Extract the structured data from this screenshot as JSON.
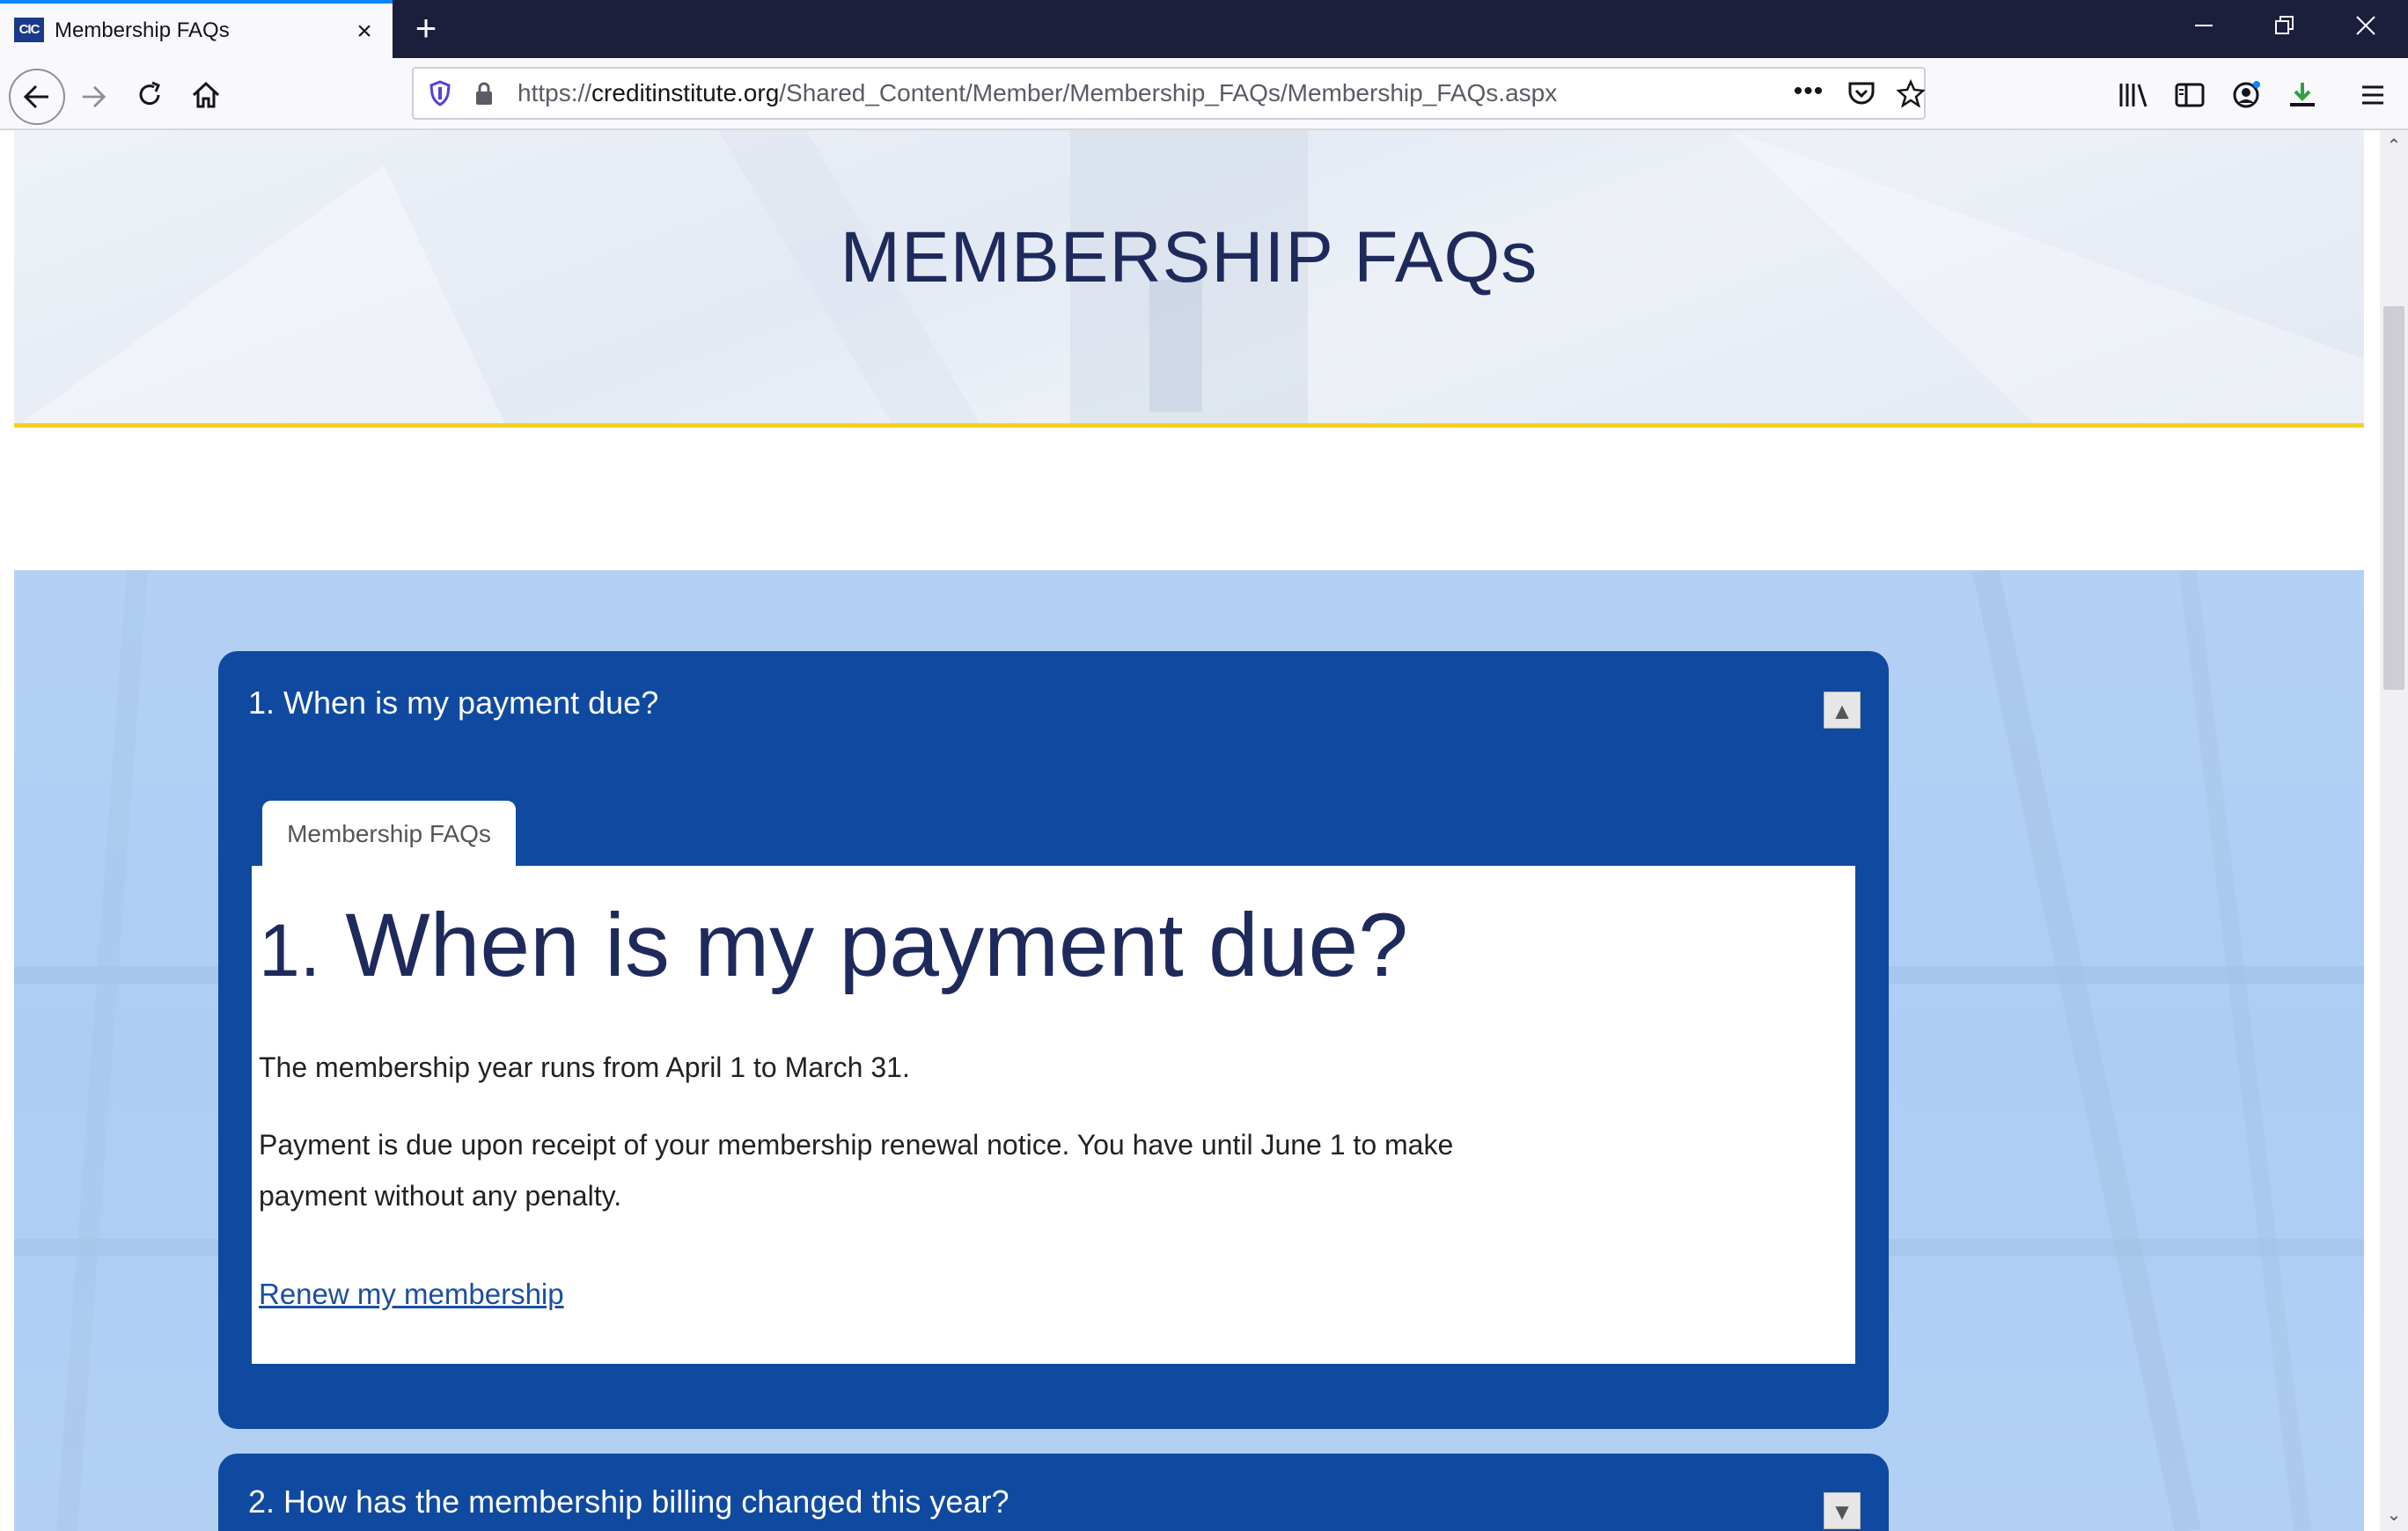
{
  "browser": {
    "tab_title": "Membership FAQs",
    "favicon_text": "CIC",
    "url_scheme": "https://",
    "url_host": "creditinstitute.org",
    "url_path": "/Shared_Content/Member/Membership_FAQs/Membership_FAQs.aspx",
    "url_more": "•••",
    "accent_color": "#0a84ff"
  },
  "page": {
    "hero_title": "MEMBERSHIP FAQs",
    "accent_yellow": "#f3cf20",
    "faq_color": "#0f4aa0"
  },
  "faqs": [
    {
      "question": "1. When is my payment due?",
      "expanded": true,
      "toggle_symbol": "▲",
      "tab_label": "Membership FAQs",
      "heading_number": "1.",
      "heading_text": " When is my payment due?",
      "paragraph_1": "The membership year runs from April 1 to March 31.",
      "paragraph_2": "Payment is due upon receipt of your membership renewal notice.  You have until June 1 to make payment without any penalty.",
      "link_text": "Renew my membership"
    },
    {
      "question": "2. How has the membership billing changed this year?",
      "expanded": false,
      "toggle_symbol": "▼"
    }
  ]
}
